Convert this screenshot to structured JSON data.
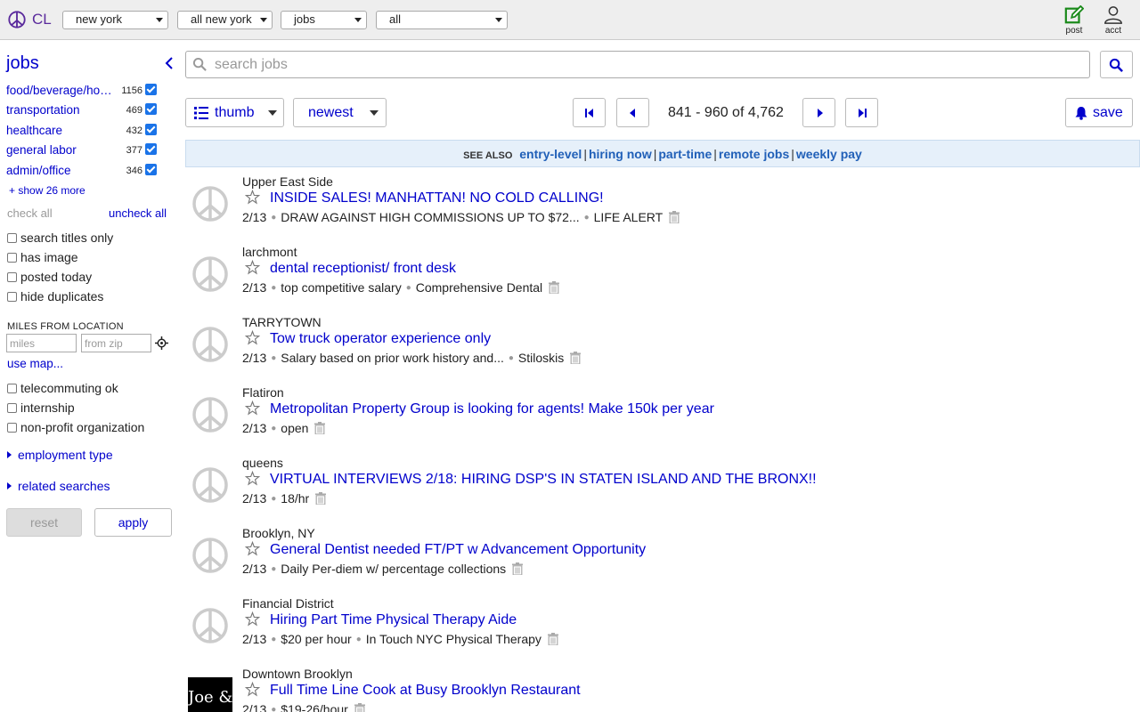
{
  "header": {
    "logo_text": "CL",
    "dropdowns": [
      "new york",
      "all new york",
      "jobs",
      "all"
    ],
    "post_label": "post",
    "account_label": "acct"
  },
  "sidebar": {
    "title": "jobs",
    "categories": [
      {
        "name": "food/beverage/hospitality",
        "count": "1156"
      },
      {
        "name": "transportation",
        "count": "469"
      },
      {
        "name": "healthcare",
        "count": "432"
      },
      {
        "name": "general labor",
        "count": "377"
      },
      {
        "name": "admin/office",
        "count": "346"
      }
    ],
    "show_more": "+ show 26 more",
    "check_all": "check all",
    "uncheck_all": "uncheck all",
    "filters": [
      "search titles only",
      "has image",
      "posted today",
      "hide duplicates"
    ],
    "miles_label": "MILES FROM LOCATION",
    "miles_placeholder": "miles",
    "zip_placeholder": "from zip",
    "use_map": "use map...",
    "options": [
      "telecommuting ok",
      "internship",
      "non-profit organization"
    ],
    "employment_type": "employment type",
    "related_searches": "related searches",
    "reset": "reset",
    "apply": "apply"
  },
  "search": {
    "placeholder": "search jobs"
  },
  "toolbar": {
    "view_label": "thumb",
    "sort_label": "newest",
    "range_text": "841 - 960 of 4,762",
    "save_label": "save"
  },
  "see_also": {
    "label": "SEE ALSO",
    "links": [
      "entry-level",
      "hiring now",
      "part-time",
      "remote jobs",
      "weekly pay"
    ]
  },
  "listings": [
    {
      "location": "Upper East Side",
      "title": "INSIDE SALES! MANHATTAN! NO COLD CALLING!",
      "date": "2/13",
      "details": [
        "DRAW AGAINST HIGH COMMISSIONS UP TO $72...",
        "LIFE ALERT"
      ],
      "thumb": "peace"
    },
    {
      "location": "larchmont",
      "title": "dental receptionist/ front desk",
      "date": "2/13",
      "details": [
        "top competitive salary",
        "Comprehensive Dental"
      ],
      "thumb": "peace"
    },
    {
      "location": "TARRYTOWN",
      "title": "Tow truck operator experience only",
      "date": "2/13",
      "details": [
        "Salary based on prior work history and...",
        "Stiloskis"
      ],
      "thumb": "peace"
    },
    {
      "location": "Flatiron",
      "title": "Metropolitan Property Group is looking for agents! Make 150k per year",
      "date": "2/13",
      "details": [
        "open"
      ],
      "thumb": "peace"
    },
    {
      "location": "queens",
      "title": "VIRTUAL INTERVIEWS 2/18: HIRING DSP'S IN STATEN ISLAND AND THE BRONX!!",
      "date": "2/13",
      "details": [
        "18/hr"
      ],
      "thumb": "peace"
    },
    {
      "location": "Brooklyn, NY",
      "title": "General Dentist needed FT/PT w Advancement Opportunity",
      "date": "2/13",
      "details": [
        "Daily Per-diem w/ percentage collections"
      ],
      "thumb": "peace"
    },
    {
      "location": "Financial District",
      "title": "Hiring Part Time Physical Therapy Aide",
      "date": "2/13",
      "details": [
        "$20 per hour",
        "In Touch NYC Physical Therapy"
      ],
      "thumb": "peace"
    },
    {
      "location": "Downtown Brooklyn",
      "title": "Full Time Line Cook at Busy Brooklyn Restaurant",
      "date": "2/13",
      "details": [
        "$19-26/hour"
      ],
      "thumb": "image",
      "thumb_text": "Joe & Toll"
    }
  ]
}
